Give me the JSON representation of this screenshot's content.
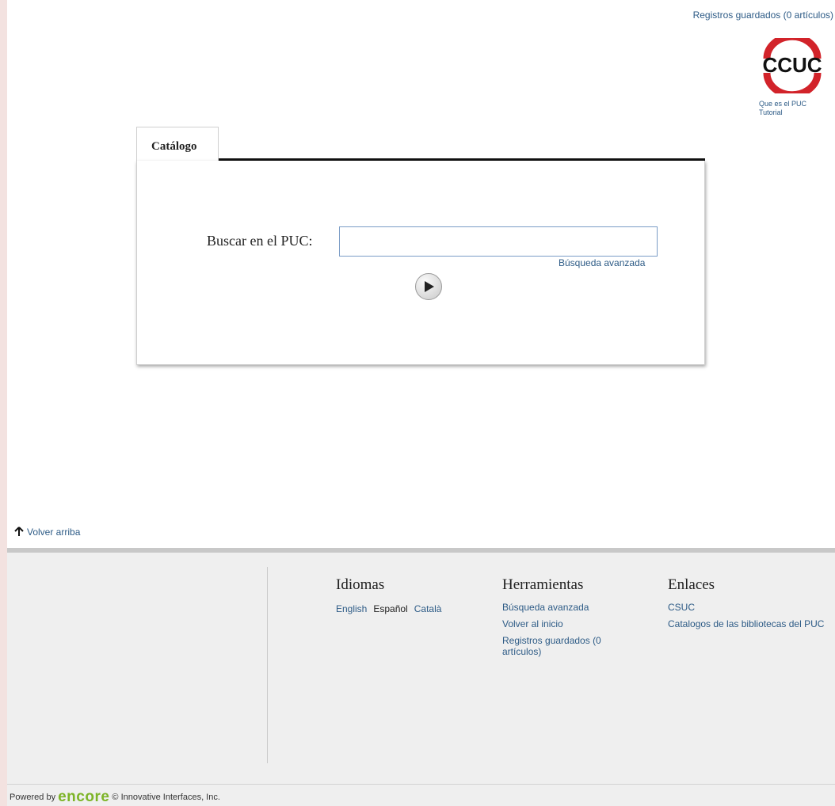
{
  "header": {
    "saved_records": "Registros guardados (0 artículos)"
  },
  "logo": {
    "text": "CCUC",
    "links": [
      "Que es el PUC",
      "Tutorial"
    ]
  },
  "search": {
    "tab_label": "Catálogo",
    "label": "Buscar en el PUC:",
    "value": "",
    "advanced_link": "Búsqueda avanzada",
    "go_icon": "play-icon"
  },
  "back_to_top": "Volver arriba",
  "footer": {
    "languages": {
      "title": "Idiomas",
      "items": [
        "English",
        "Español",
        "Català"
      ],
      "current": "Español"
    },
    "tools": {
      "title": "Herramientas",
      "items": [
        "Búsqueda avanzada",
        "Volver al inicio",
        "Registros guardados (0 artículos)"
      ]
    },
    "links": {
      "title": "Enlaces",
      "items": [
        "CSUC",
        "Catalogos de las bibliotecas del PUC"
      ]
    },
    "powered_prefix": "Powered by",
    "powered_brand": "encore",
    "powered_suffix": "© Innovative Interfaces, Inc."
  },
  "colors": {
    "link": "#2d5b86",
    "logo_red": "#d2232a",
    "encore_green": "#7db428"
  }
}
